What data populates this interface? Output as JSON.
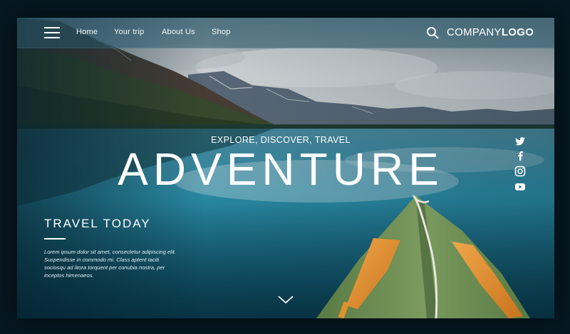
{
  "nav": {
    "links": [
      {
        "label": "Home"
      },
      {
        "label": "Your trip"
      },
      {
        "label": "About Us"
      },
      {
        "label": "Shop"
      }
    ],
    "menu_icon": "hamburger-menu-icon",
    "search_icon": "search-icon"
  },
  "logo": {
    "part1": "COMPANY",
    "part2": "LOGO"
  },
  "hero": {
    "tagline": "EXPLORE, DISCOVER, TRAVEL",
    "headline": "ADVENTURE"
  },
  "section": {
    "heading": "TRAVEL TODAY",
    "body": [
      "Lorem ipsum dolor sit amet, consectetur adipiscing elit.",
      "Suspendisse in commodo mi. Class aptent taciti",
      "sociosqu ad litora torquent per conubia nostra, per",
      "inceptos himenaeos."
    ]
  },
  "social": [
    "twitter-icon",
    "facebook-icon",
    "instagram-icon",
    "youtube-icon"
  ],
  "scroll_icon": "chevron-down-icon",
  "colors": {
    "sky": "#c9cdcf",
    "lake": "#2a8ea6",
    "navbar": "#285a6e",
    "kayak": "#6d8f52",
    "paddle": "#e0902c"
  }
}
